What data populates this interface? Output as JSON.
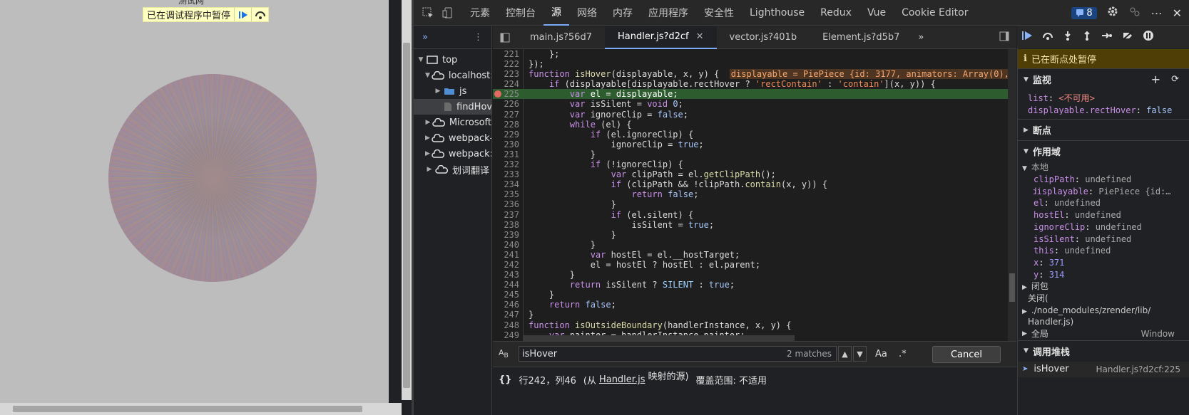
{
  "page": {
    "title": "测试网",
    "paused_label": "已在调试程序中暂停"
  },
  "topbar": {
    "tabs": [
      "元素",
      "控制台",
      "源",
      "网络",
      "内存",
      "应用程序",
      "安全性",
      "Lighthouse",
      "Redux",
      "Vue",
      "Cookie Editor"
    ],
    "active": "源",
    "issues_count": "8"
  },
  "navigator": {
    "items": [
      {
        "label": "top",
        "indent": 0,
        "icon": "frame",
        "open": true
      },
      {
        "label": "localhost:",
        "indent": 1,
        "icon": "cloud",
        "open": true
      },
      {
        "label": "js",
        "indent": 2,
        "icon": "folder",
        "open": false
      },
      {
        "label": "findHov",
        "indent": 3,
        "icon": "file",
        "sel": true
      },
      {
        "label": "Microsoft",
        "indent": 1,
        "icon": "cloud",
        "open": false
      },
      {
        "label": "webpack-",
        "indent": 1,
        "icon": "cloud",
        "open": false
      },
      {
        "label": "webpack:/",
        "indent": 1,
        "icon": "cloud",
        "open": false
      },
      {
        "label": "划词翻译",
        "indent": 1,
        "icon": "cloud",
        "open": false
      }
    ]
  },
  "file_tabs": [
    "main.js?56d7",
    "Handler.js?d2cf",
    "vector.js?401b",
    "Element.js?d5b7"
  ],
  "active_file": "Handler.js?d2cf",
  "code": {
    "start": 221,
    "exec_line": 225,
    "breakpoint_line": 225,
    "lines": [
      "    };",
      "});",
      "function isHover(displayable, x, y) {",
      "    if (displayable[displayable.rectHover ? 'rectContain' : 'contain'](x, y)) {",
      "        var el = displayable;",
      "        var isSilent = void 0;",
      "        var ignoreClip = false;",
      "        while (el) {",
      "            if (el.ignoreClip) {",
      "                ignoreClip = true;",
      "            }",
      "            if (!ignoreClip) {",
      "                var clipPath = el.getClipPath();",
      "                if (clipPath && !clipPath.contain(x, y)) {",
      "                    return false;",
      "                }",
      "                if (el.silent) {",
      "                    isSilent = true;",
      "                }",
      "            }",
      "            var hostEl = el.__hostTarget;",
      "            el = hostEl ? hostEl : el.parent;",
      "        }",
      "        return isSilent ? SILENT : true;",
      "    }",
      "    return false;",
      "}",
      "function isOutsideBoundary(handlerInstance, x, y) {",
      "    var painter = handlerInstance.painter;"
    ],
    "inline_value": "displayable = PiePiece {id: 3177, animators: Array(0),"
  },
  "search": {
    "query": "isHover",
    "matches": "2 matches",
    "cancel": "Cancel",
    "aa": "Aa",
    "regex": ".*"
  },
  "status": {
    "position": "行242，列46",
    "from": "(从",
    "file": "Handler.js",
    "mapped": "映射的源)",
    "coverage": "覆盖范围: 不适用"
  },
  "sidebar": {
    "paused": "已在断点处暂停",
    "watch_title": "监视",
    "watch": [
      {
        "k": "list",
        "v": "<不可用>"
      },
      {
        "k": "displayable.rectHover",
        "v": "false"
      }
    ],
    "breakpoints_title": "断点",
    "scope_title": "作用域",
    "local_title": "本地",
    "scope": [
      {
        "k": "clipPath",
        "v": "undefined"
      },
      {
        "k": "displayable",
        "v": "PiePiece {id:…",
        "exp": true
      },
      {
        "k": "el",
        "v": "undefined"
      },
      {
        "k": "hostEl",
        "v": "undefined"
      },
      {
        "k": "ignoreClip",
        "v": "undefined"
      },
      {
        "k": "isSilent",
        "v": "undefined"
      },
      {
        "k": "this",
        "v": "undefined"
      },
      {
        "k": "x",
        "v": "371"
      },
      {
        "k": "y",
        "v": "314"
      }
    ],
    "closure_title": "闭包",
    "closure2": "关闭(",
    "closure2_path": "./node_modules/zrender/lib/",
    "closure2_file": "Handler.js)",
    "global_title": "全局",
    "global_value": "Window",
    "callstack_title": "调用堆栈",
    "callstack": [
      {
        "fn": "isHover",
        "loc": "Handler.js?d2cf:225"
      }
    ]
  }
}
